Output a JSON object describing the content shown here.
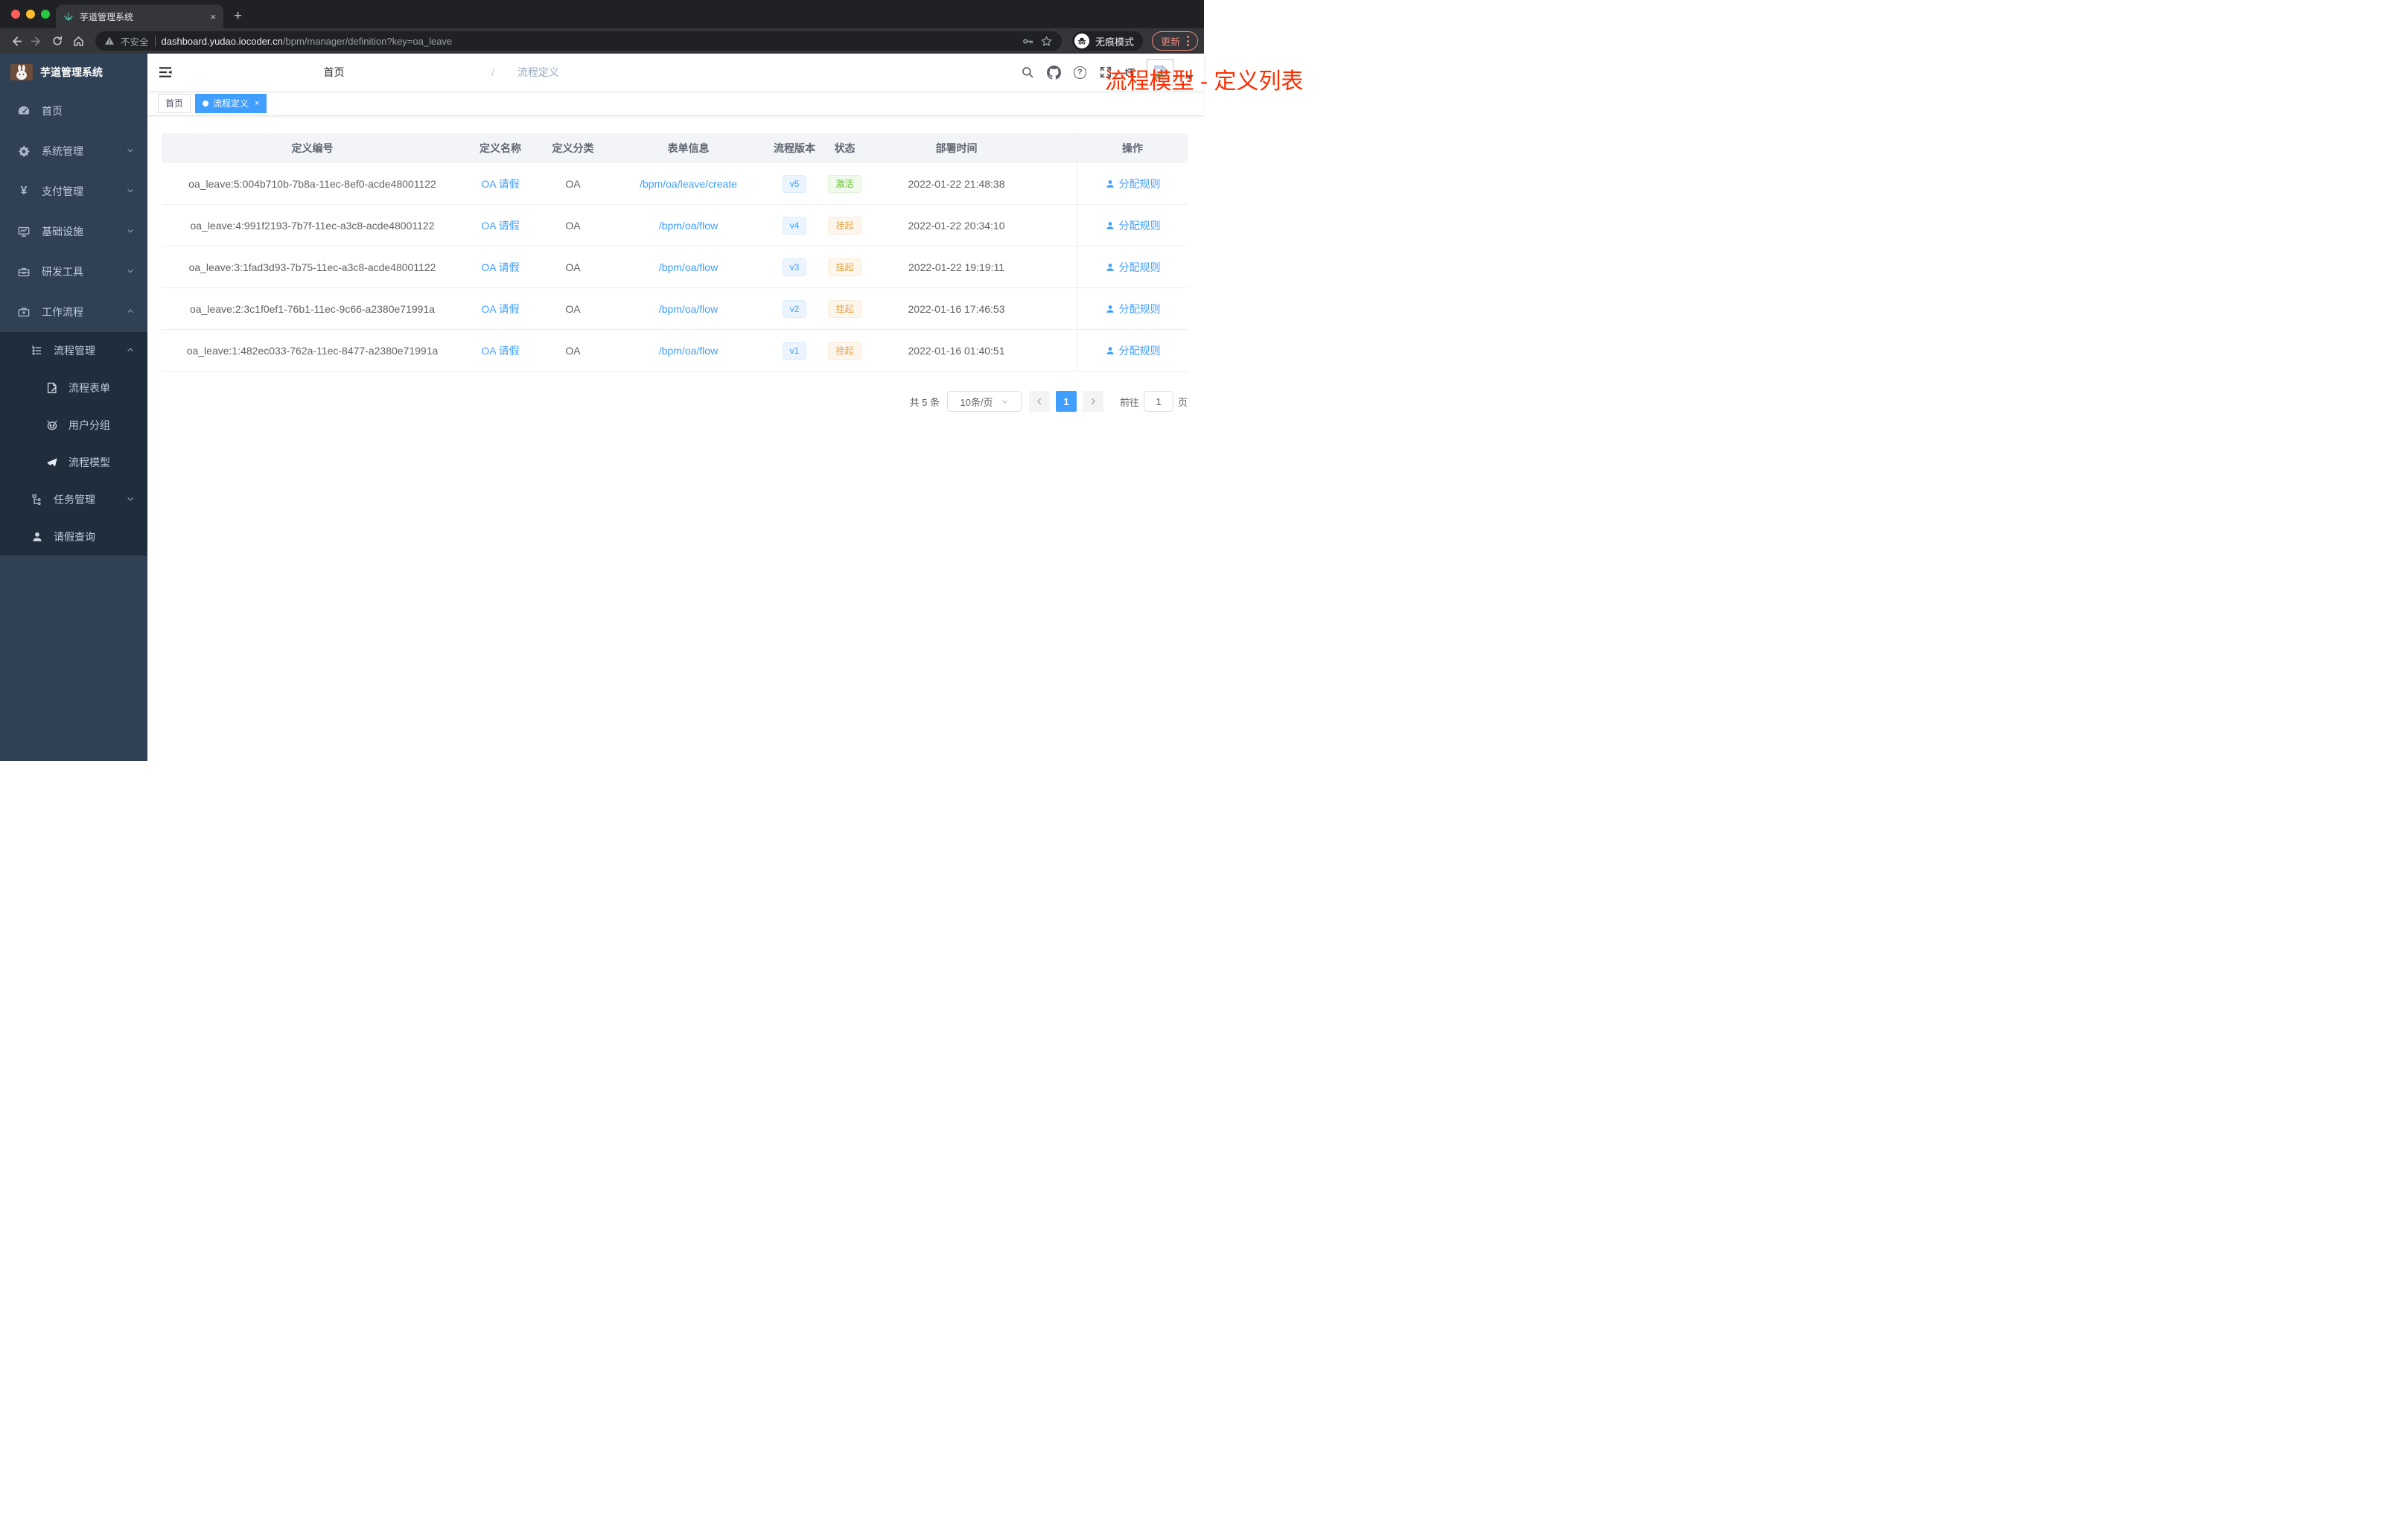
{
  "browser": {
    "tab": {
      "title": "芋道管理系统",
      "close_glyph": "×",
      "new_tab_glyph": "+"
    },
    "toolbar": {
      "security_label": "不安全",
      "url_host": "dashboard.yudao.iocoder.cn",
      "url_path": "/bpm/manager/definition?key=oa_leave",
      "incognito_label": "无痕模式",
      "update_label": "更新"
    }
  },
  "sidebar": {
    "app_title": "芋道管理系统",
    "items": [
      {
        "label": "首页",
        "icon": "dashboard-icon"
      },
      {
        "label": "系统管理",
        "icon": "gear-icon"
      },
      {
        "label": "支付管理",
        "icon": "yen-icon"
      },
      {
        "label": "基础设施",
        "icon": "monitor-icon"
      },
      {
        "label": "研发工具",
        "icon": "toolbox-icon"
      },
      {
        "label": "工作流程",
        "icon": "briefcase-icon"
      }
    ],
    "submenu": {
      "process_manage": {
        "label": "流程管理",
        "icon": "list-icon"
      },
      "children": [
        {
          "label": "流程表单",
          "icon": "form-icon"
        },
        {
          "label": "用户分组",
          "icon": "robot-icon"
        },
        {
          "label": "流程模型",
          "icon": "paper-plane-icon"
        }
      ],
      "task_manage": {
        "label": "任务管理",
        "icon": "tree-icon"
      },
      "leave_query": {
        "label": "请假查询",
        "icon": "person-icon"
      }
    }
  },
  "header": {
    "breadcrumb": {
      "home": "首页",
      "separator": "/",
      "current": "流程定义"
    },
    "annotation": "流程模型 - 定义列表",
    "icons": {
      "question_glyph": "?",
      "font_size_glyph": "tT"
    }
  },
  "tags": {
    "home": {
      "label": "首页"
    },
    "active": {
      "label": "流程定义",
      "close_glyph": "×"
    }
  },
  "table": {
    "columns": [
      "定义编号",
      "定义名称",
      "定义分类",
      "表单信息",
      "流程版本",
      "状态",
      "部署时间",
      "操作"
    ],
    "action_label": "分配规则",
    "rows": [
      {
        "id": "oa_leave:5:004b710b-7b8a-11ec-8ef0-acde48001122",
        "name": "OA 请假",
        "category": "OA",
        "form": "/bpm/oa/leave/create",
        "version": "v5",
        "status": "激活",
        "status_type": "success",
        "deploy_time": "2022-01-22 21:48:38",
        "action": "分配规则"
      },
      {
        "id": "oa_leave:4:991f2193-7b7f-11ec-a3c8-acde48001122",
        "name": "OA 请假",
        "category": "OA",
        "form": "/bpm/oa/flow",
        "version": "v4",
        "status": "挂起",
        "status_type": "warning",
        "deploy_time": "2022-01-22 20:34:10",
        "action": "分配规则"
      },
      {
        "id": "oa_leave:3:1fad3d93-7b75-11ec-a3c8-acde48001122",
        "name": "OA 请假",
        "category": "OA",
        "form": "/bpm/oa/flow",
        "version": "v3",
        "status": "挂起",
        "status_type": "warning",
        "deploy_time": "2022-01-22 19:19:11",
        "action": "分配规则"
      },
      {
        "id": "oa_leave:2:3c1f0ef1-76b1-11ec-9c66-a2380e71991a",
        "name": "OA 请假",
        "category": "OA",
        "form": "/bpm/oa/flow",
        "version": "v2",
        "status": "挂起",
        "status_type": "warning",
        "deploy_time": "2022-01-16 17:46:53",
        "action": "分配规则"
      },
      {
        "id": "oa_leave:1:482ec033-762a-11ec-8477-a2380e71991a",
        "name": "OA 请假",
        "category": "OA",
        "form": "/bpm/oa/flow",
        "version": "v1",
        "status": "挂起",
        "status_type": "warning",
        "deploy_time": "2022-01-16 01:40:51",
        "action": "分配规则"
      }
    ]
  },
  "pagination": {
    "total_label": "共 5 条",
    "page_size_label": "10条/页",
    "current_page": "1",
    "goto_label": "前往",
    "goto_value": "1",
    "page_unit_label": "页"
  },
  "colors": {
    "accent": "#409eff",
    "success": "#67c23a",
    "warning": "#e6a23c",
    "sidebar_bg": "#304156",
    "submenu_bg": "#1f2d3d",
    "annotation_red": "#fb2e00"
  }
}
